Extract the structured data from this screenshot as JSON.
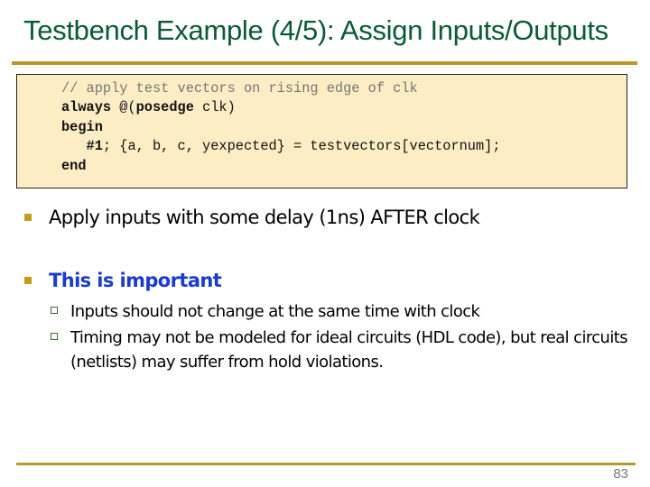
{
  "slide": {
    "title": "Testbench Example (4/5): Assign Inputs/Outputs",
    "page_number": "83",
    "colors": {
      "title": "#0b5a36",
      "rule": "#b8992e",
      "code_background": "#fdedc4",
      "bullet": "#c79b1a",
      "emphasis": "#1a3ccc"
    }
  },
  "code": {
    "lines": [
      {
        "segments": [
          {
            "text": "// apply test vectors on rising edge of clk",
            "style": "comment"
          }
        ]
      },
      {
        "segments": [
          {
            "text": "always",
            "style": "kw"
          },
          {
            "text": " @(",
            "style": ""
          },
          {
            "text": "posedge",
            "style": "kw"
          },
          {
            "text": " clk)",
            "style": ""
          }
        ]
      },
      {
        "segments": [
          {
            "text": "begin",
            "style": "kw"
          }
        ]
      },
      {
        "segments": [
          {
            "text": "   ",
            "style": ""
          },
          {
            "text": "#1",
            "style": "kw"
          },
          {
            "text": "; {a, b, c, yexpected} = testvectors[vectornum];",
            "style": ""
          }
        ]
      },
      {
        "segments": [
          {
            "text": "end",
            "style": "kw"
          }
        ]
      }
    ]
  },
  "bullets": [
    {
      "text": "Apply inputs with some delay (1ns) AFTER clock",
      "icon": "square-bullet"
    },
    {
      "text": "This is important",
      "icon": "square-bullet",
      "emphasis": true,
      "sub_bullets": [
        {
          "text": "Inputs should not change at the same time with clock",
          "icon": "hollow-square-bullet"
        },
        {
          "text": "Timing may not be modeled for ideal circuits (HDL code), but real circuits (netlists) may suffer from hold violations.",
          "icon": "hollow-square-bullet"
        }
      ]
    }
  ]
}
